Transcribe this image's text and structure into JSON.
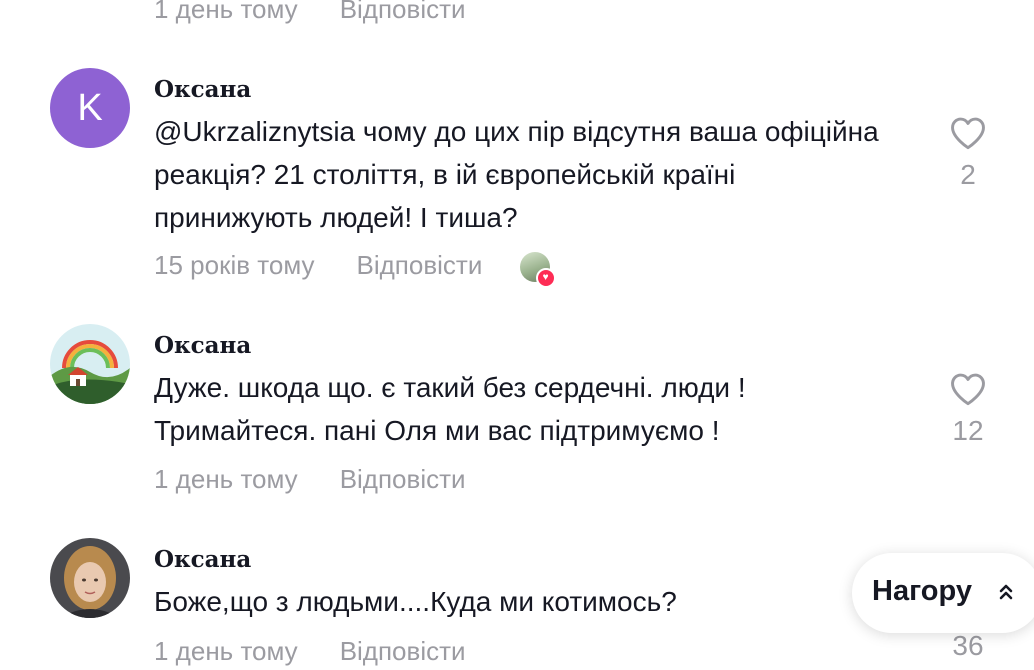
{
  "previous_comment": {
    "time": "1 день тому",
    "reply_label": "Відповісти"
  },
  "comments": [
    {
      "avatar_letter": "K",
      "avatar_color": "#8e62d3",
      "author": "Оксана",
      "text": "@Ukrzaliznytsia чому до цих пір відсутня ваша офіційна реакція? 21 століття, в ій європейській країні принижують людей! І тиша?",
      "time": "15 років тому",
      "reply_label": "Відповісти",
      "likes": "2",
      "liked_by_creator": true
    },
    {
      "author": "Оксана",
      "text": "Дуже. шкода що. є такий без сердечні. люди ! Тримайтеся. пані Оля ми вас підтримуємо !",
      "time": "1 день тому",
      "reply_label": "Відповісти",
      "likes": "12"
    },
    {
      "author": "Оксана",
      "text": "Боже,що з людьми....Куда ми котимось?",
      "time": "1 день тому",
      "reply_label": "Відповісти",
      "likes": "36"
    }
  ],
  "back_to_top": {
    "label": "Нагору",
    "icon": "double-chevron-up-icon"
  },
  "colors": {
    "muted": "#9b9ba1",
    "text": "#161823",
    "accent": "#fe2c55"
  }
}
